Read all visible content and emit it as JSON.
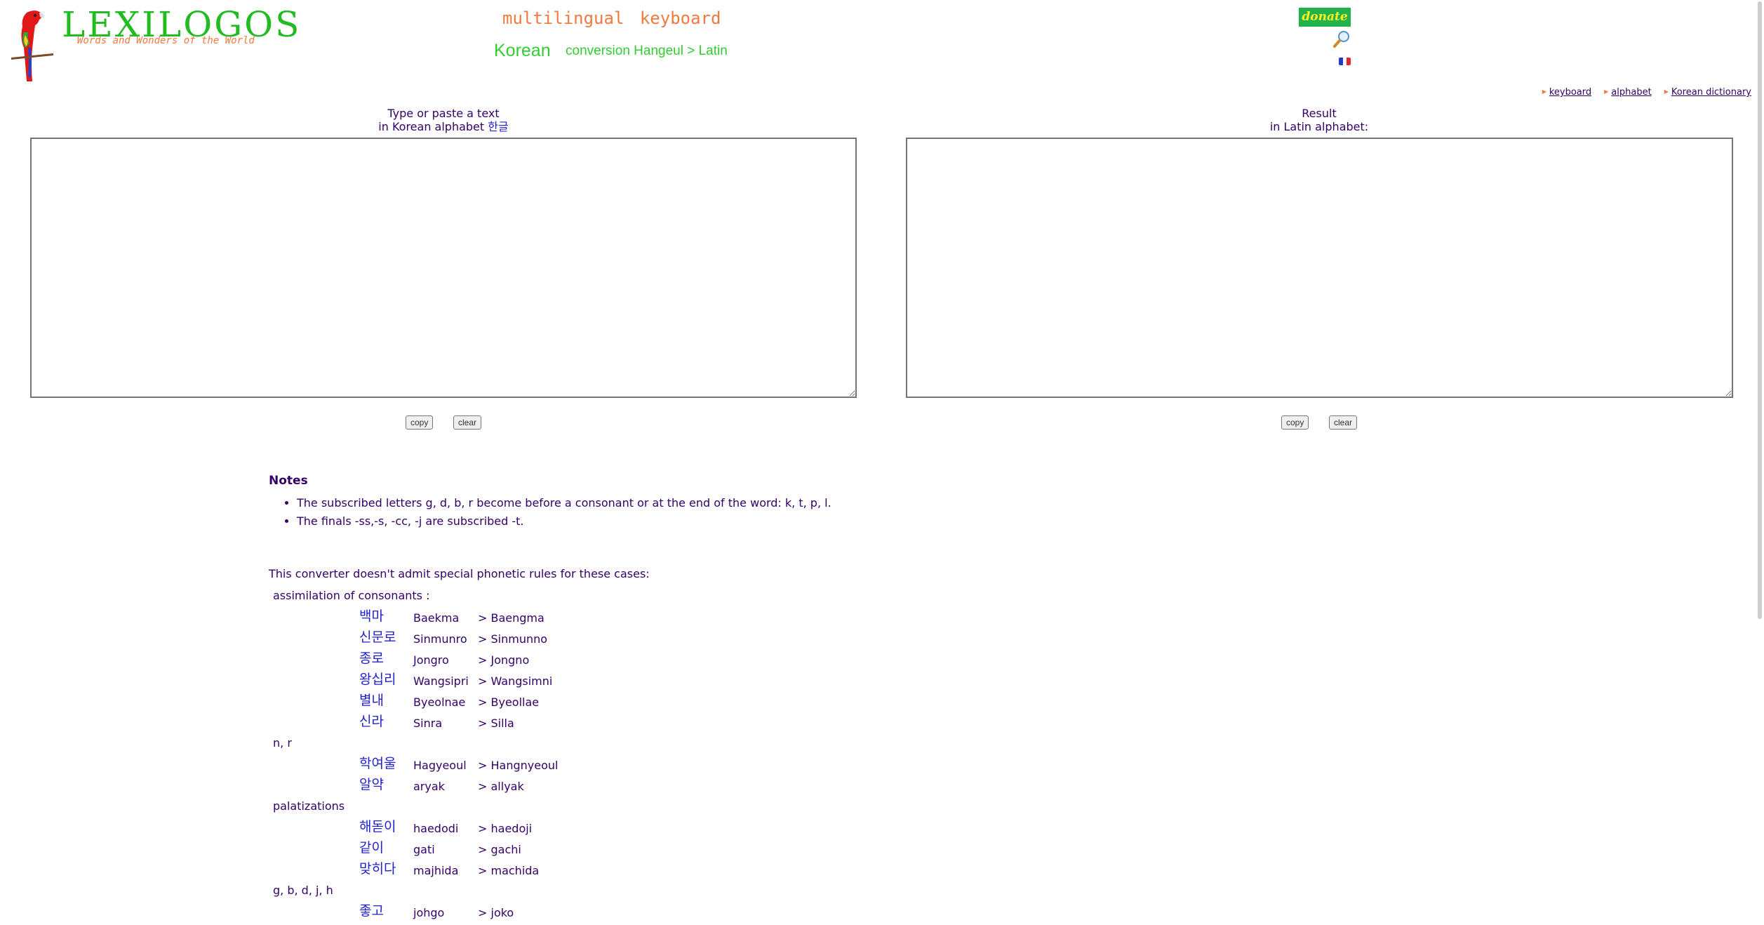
{
  "logo": {
    "title": "LEXILOGOS",
    "tagline": "Words and Wonders of the World",
    "mascot_icon": "parrot-icon"
  },
  "header": {
    "keyboard_title": "multilingual  keyboard",
    "language": "Korean",
    "conversion": "conversion Hangeul > Latin",
    "donate_label": "donate",
    "search_icon": "magnifier-icon",
    "language_switch_icon": "french-flag-icon"
  },
  "top_links": [
    {
      "label": "keyboard"
    },
    {
      "label": "alphabet"
    },
    {
      "label": "Korean dictionary"
    }
  ],
  "input_panel": {
    "label_line1": "Type or paste a text",
    "label_line2": "in Korean alphabet",
    "label_hangul": "한글",
    "value": "",
    "copy_label": "copy",
    "clear_label": "clear"
  },
  "output_panel": {
    "label_line1": "Result",
    "label_line2": "in Latin alphabet:",
    "value": "",
    "copy_label": "copy",
    "clear_label": "clear"
  },
  "notes": {
    "title": "Notes",
    "items": [
      "The subscribed letters g, d, b, r become before a consonant or at the end of the word: k, t, p, l.",
      "The finals -ss,-s, -cc, -j are subscribed -t."
    ]
  },
  "cases": {
    "intro": "This converter doesn't admit special phonetic rules for these cases:",
    "groups": [
      {
        "title": "assimilation of consonants :",
        "rows": [
          {
            "korean": "백마",
            "roman": "Baekma",
            "result": "> Baengma"
          },
          {
            "korean": "신문로",
            "roman": "Sinmunro",
            "result": "> Sinmunno"
          },
          {
            "korean": "종로",
            "roman": "Jongro",
            "result": "> Jongno"
          },
          {
            "korean": "왕십리",
            "roman": "Wangsipri",
            "result": "> Wangsimni"
          },
          {
            "korean": "별내",
            "roman": "Byeolnae",
            "result": "> Byeollae"
          },
          {
            "korean": "신라",
            "roman": "Sinra",
            "result": "> Silla"
          }
        ]
      },
      {
        "title": "n, r",
        "rows": [
          {
            "korean": "학여울",
            "roman": "Hagyeoul",
            "result": "> Hangnyeoul"
          },
          {
            "korean": "알약",
            "roman": "aryak",
            "result": "> allyak"
          }
        ]
      },
      {
        "title": "palatizations",
        "rows": [
          {
            "korean": "해돋이",
            "roman": "haedodi",
            "result": "> haedoji"
          },
          {
            "korean": "같이",
            "roman": "gati",
            "result": "> gachi"
          },
          {
            "korean": "맞히다",
            "roman": "majhida",
            "result": "> machida"
          }
        ]
      },
      {
        "title": "g, b, d, j, h",
        "rows": [
          {
            "korean": "좋고",
            "roman": "johgo",
            "result": "> joko"
          }
        ]
      }
    ]
  },
  "colors": {
    "brand_green": "#22bb22",
    "accent_orange": "#f07a40",
    "text_purple": "#330066",
    "hangul_blue": "#2222cc",
    "donate_bg": "#22b24c",
    "donate_text": "#ffee22"
  }
}
